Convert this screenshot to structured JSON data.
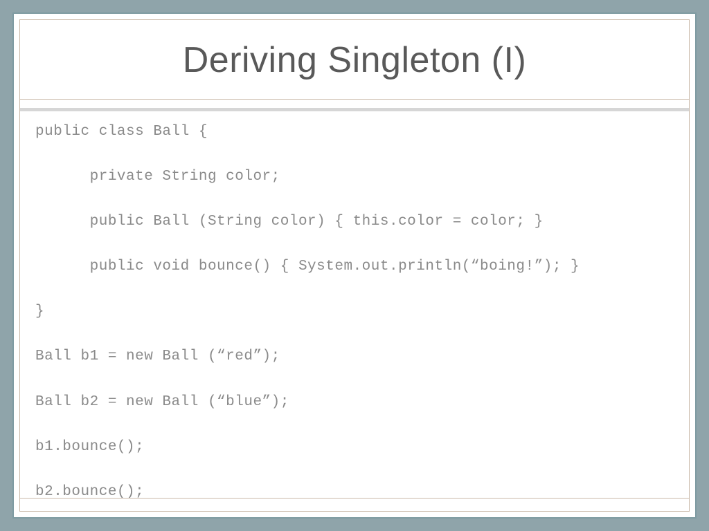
{
  "slide": {
    "title": "Deriving Singleton (I)",
    "code_lines": [
      "public class Ball {",
      "",
      "      private String color;",
      "",
      "      public Ball (String color) { this.color = color; }",
      "",
      "      public void bounce() { System.out.println(“boing!”); }",
      "",
      "}",
      "",
      "Ball b1 = new Ball (“red”);",
      "",
      "Ball b2 = new Ball (“blue”);",
      "",
      "b1.bounce();",
      "",
      "b2.bounce();"
    ]
  }
}
